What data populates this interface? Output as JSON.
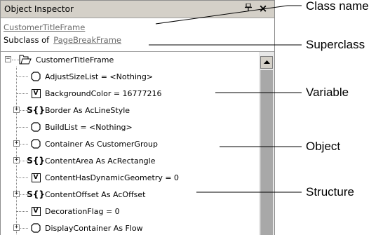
{
  "window": {
    "title": "Object Inspector",
    "pin_glyph": "📌",
    "close_glyph": "×"
  },
  "header": {
    "class_name": "CustomerTitleFrame",
    "subclass_prefix": "Subclass of",
    "superclass_name": "PageBreakFrame"
  },
  "tree": {
    "root": {
      "label": "CustomerTitleFrame",
      "icon": "folder-icon",
      "expander": "−"
    },
    "items": [
      {
        "label": "AdjustSizeList = <Nothing>",
        "icon": "object-icon",
        "expandable": false
      },
      {
        "label": "BackgroundColor = 16777216",
        "icon": "variable-icon",
        "expandable": false
      },
      {
        "label": "Border As AcLineStyle",
        "icon": "structure-icon",
        "expandable": true
      },
      {
        "label": "BuildList = <Nothing>",
        "icon": "object-icon",
        "expandable": false
      },
      {
        "label": "Container As CustomerGroup",
        "icon": "object-icon",
        "expandable": true
      },
      {
        "label": "ContentArea As AcRectangle",
        "icon": "structure-icon",
        "expandable": true
      },
      {
        "label": "ContentHasDynamicGeometry = 0",
        "icon": "variable-icon",
        "expandable": false
      },
      {
        "label": "ContentOffset As AcOffset",
        "icon": "structure-icon",
        "expandable": true
      },
      {
        "label": "DecorationFlag = 0",
        "icon": "variable-icon",
        "expandable": false
      },
      {
        "label": "DisplayContainer As Flow",
        "icon": "object-icon",
        "expandable": true
      }
    ],
    "variable_icon_text": "V",
    "structure_icon_text": "S{}",
    "expander_plus": "+"
  },
  "callouts": {
    "class_name": "Class name",
    "superclass": "Superclass",
    "variable": "Variable",
    "object": "Object",
    "structure": "Structure"
  }
}
